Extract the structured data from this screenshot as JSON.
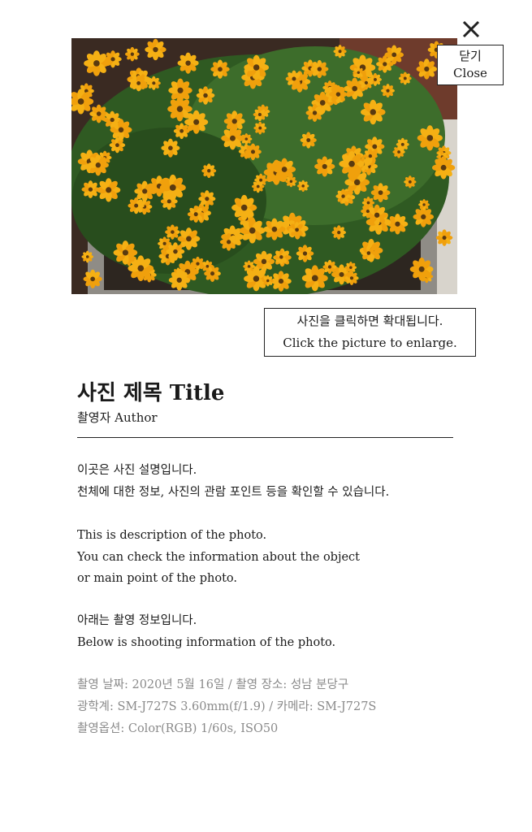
{
  "close": {
    "label_ko": "닫기",
    "label_en": "Close",
    "icon": "close-icon"
  },
  "photo": {
    "subject": "yellow flowers in a planter"
  },
  "enlarge_hint": {
    "ko": "사진을 클릭하면 확대됩니다.",
    "en": "Click the picture to enlarge."
  },
  "title": "사진 제목 Title",
  "author": "촬영자 Author",
  "description": {
    "ko_lines": [
      "이곳은 사진 설명입니다.",
      "천체에 대한 정보, 사진의 관람 포인트 등을 확인할 수 있습니다."
    ],
    "en_lines": [
      "This is description of the photo.",
      "You can check the information about the object",
      "or main point of the photo."
    ],
    "shooting_lines": [
      "아래는 촬영 정보입니다.",
      "Below is shooting information of the photo."
    ]
  },
  "shooting_info": [
    "촬영 날짜: 2020년 5월 16일 / 촬영 장소: 성남 분당구",
    "광학계: SM-J727S 3.60mm(f/1.9) / 카메라: SM-J727S",
    "촬영옵션: Color(RGB) 1/60s, ISO50"
  ],
  "colors": {
    "text": "#1a1a1a",
    "muted": "#8a8a8a",
    "petal": "#f5b014",
    "leaf": "#2f5a22"
  }
}
